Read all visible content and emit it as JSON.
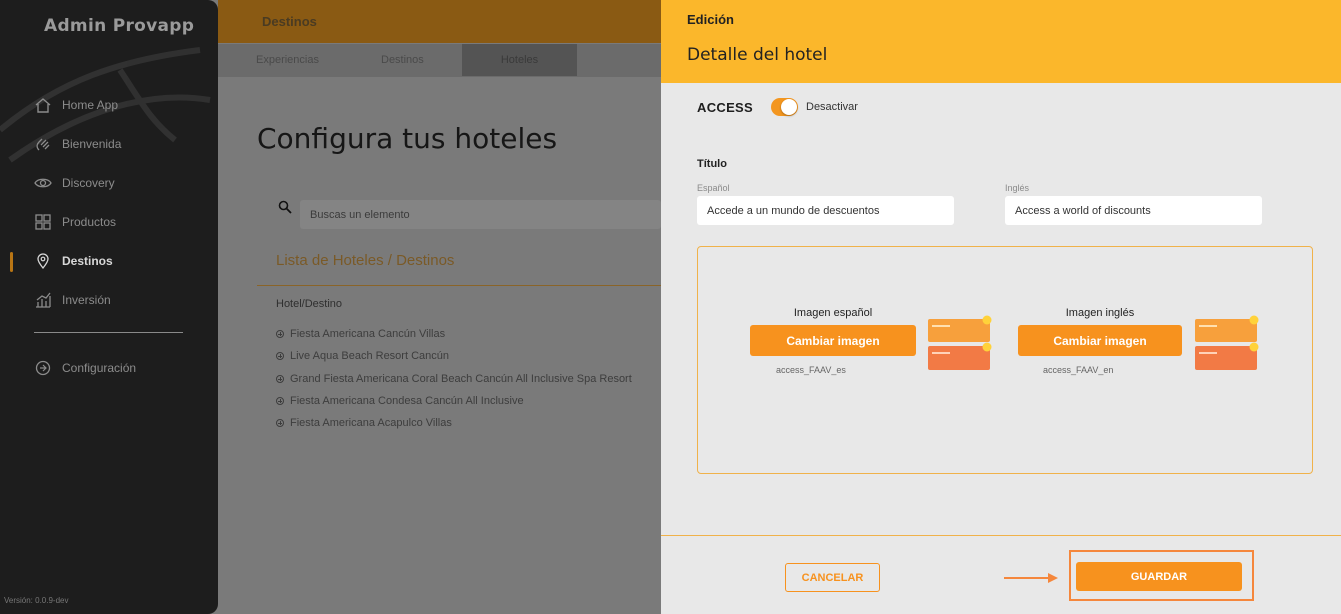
{
  "sidebar": {
    "brand": "Admin Provapp",
    "items": [
      {
        "label": "Home App",
        "icon": "home-icon"
      },
      {
        "label": "Bienvenida",
        "icon": "wave-hand-icon"
      },
      {
        "label": "Discovery",
        "icon": "eye-icon"
      },
      {
        "label": "Productos",
        "icon": "grid-icon"
      },
      {
        "label": "Destinos",
        "icon": "map-pin-icon",
        "active": true
      },
      {
        "label": "Inversión",
        "icon": "chart-icon"
      }
    ],
    "settings": {
      "label": "Configuración",
      "icon": "settings-icon"
    },
    "version": "Versión: 0.0.9-dev"
  },
  "background": {
    "section_title": "Destinos",
    "tabs": [
      {
        "label": "Experiencias"
      },
      {
        "label": "Destinos"
      },
      {
        "label": "Hoteles",
        "selected": true
      }
    ],
    "page_title": "Configura tus hoteles",
    "search_placeholder": "Buscas un elemento",
    "list_title": "Lista de Hoteles / Destinos",
    "column_header": "Hotel/Destino",
    "hotels": [
      "Fiesta Americana Cancún Villas",
      "Live Aqua Beach Resort Cancún",
      "Grand Fiesta Americana Coral Beach Cancún All Inclusive Spa Resort",
      "Fiesta Americana Condesa Cancún All Inclusive",
      "Fiesta Americana Acapulco Villas"
    ]
  },
  "panel": {
    "kicker": "Edición",
    "title": "Detalle del hotel",
    "access_label": "ACCESS",
    "toggle_label": "Desactivar",
    "toggle_on": true,
    "section_title": "Título",
    "spanish_label": "Español",
    "spanish_value": "Accede a un mundo de descuentos",
    "english_label": "Inglés",
    "english_value": "Access a world of discounts",
    "image_es": {
      "title": "Imagen español",
      "button": "Cambiar imagen",
      "file": "access_FAAV_es"
    },
    "image_en": {
      "title": "Imagen inglés",
      "button": "Cambiar imagen",
      "file": "access_FAAV_en"
    },
    "cancel_label": "CANCELAR",
    "save_label": "GUARDAR"
  },
  "colors": {
    "accent": "#f7921e",
    "header": "#fbb72b",
    "sidebar": "#1d1d1d"
  }
}
